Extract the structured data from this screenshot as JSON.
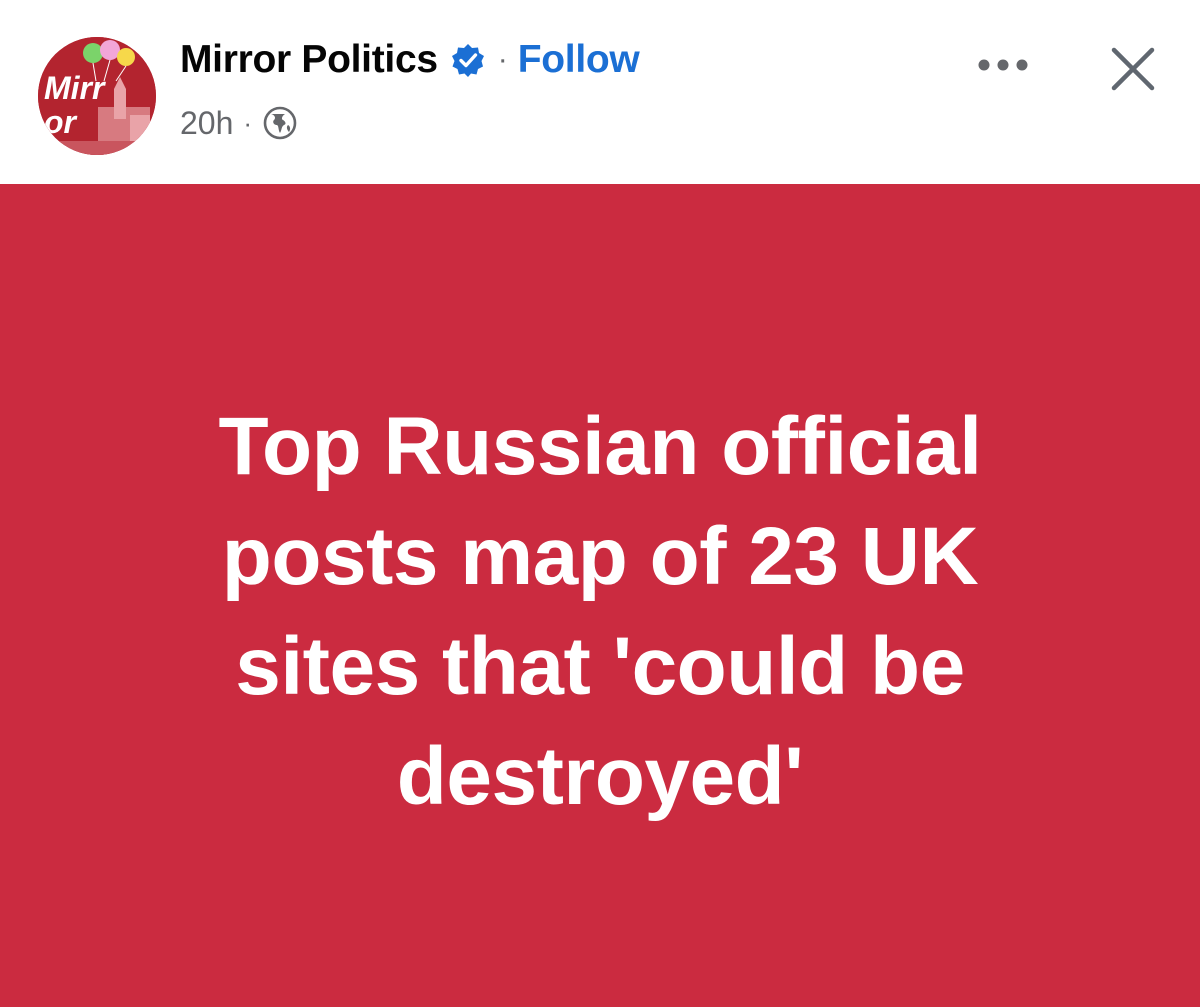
{
  "post": {
    "page_name": "Mirror Politics",
    "follow_label": "Follow",
    "separator": "·",
    "timestamp": "20h",
    "meta_separator": "·",
    "audience_icon": "globe-icon",
    "verified_icon": "verified-badge-icon",
    "more_icon": "more-options-icon",
    "close_icon": "close-icon",
    "avatar": {
      "logo_text": "Mirror"
    }
  },
  "headline": {
    "lines": [
      "Top Russian official",
      "posts map of 23 UK",
      "sites that 'could be",
      "destroyed'"
    ]
  },
  "colors": {
    "banner_background": "#cb2b40",
    "headline_text": "#ffffff",
    "follow_link": "#1b6fd4",
    "verified_badge": "#1b6fd4",
    "secondary_text": "#65676b"
  }
}
